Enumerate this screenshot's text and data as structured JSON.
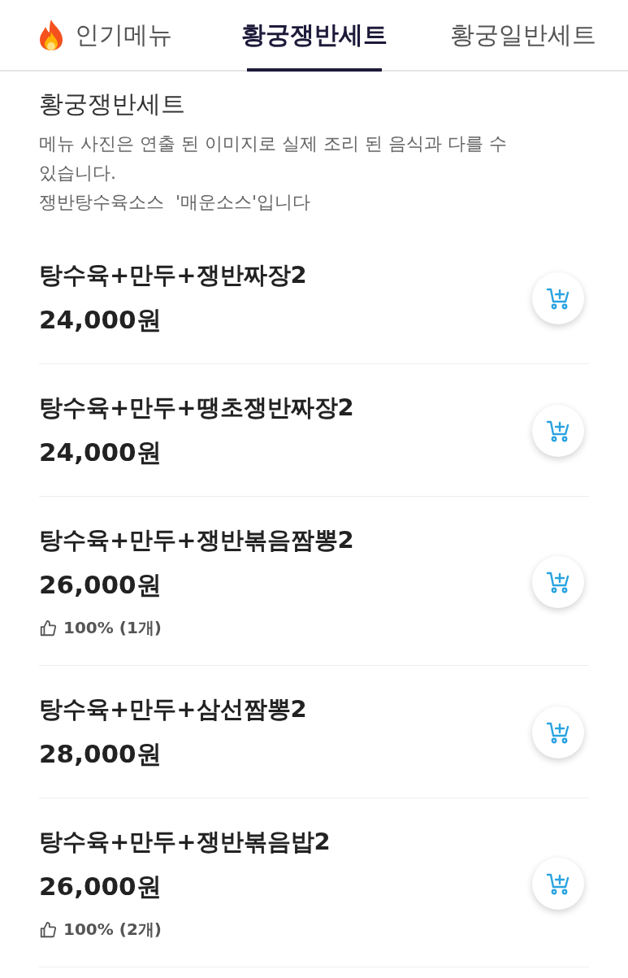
{
  "tabs": [
    {
      "label": "인기메뉴",
      "selected": false,
      "kind": "hot"
    },
    {
      "label": "황궁쟁반세트",
      "selected": true,
      "kind": "plain"
    },
    {
      "label": "황궁일반세트",
      "selected": false,
      "kind": "plain"
    }
  ],
  "section": {
    "title": "황궁쟁반세트",
    "notes": [
      "메뉴 사진은 연출 된 이미지로 실제 조리 된 음식과 다를 수 있습니다.",
      "쟁반탕수육소스  '매운소스'입니다"
    ]
  },
  "items": [
    {
      "name": "탕수육+만두+쟁반짜장2",
      "price": "24,000원"
    },
    {
      "name": "탕수육+만두+땡초쟁반짜장2",
      "price": "24,000원"
    },
    {
      "name": "탕수육+만두+쟁반볶음짬뽕2",
      "price": "26,000원",
      "rating": "100% (1개)"
    },
    {
      "name": "탕수육+만두+삼선짬뽕2",
      "price": "28,000원"
    },
    {
      "name": "탕수육+만두+쟁반볶음밥2",
      "price": "26,000원",
      "rating": "100% (2개)"
    }
  ]
}
